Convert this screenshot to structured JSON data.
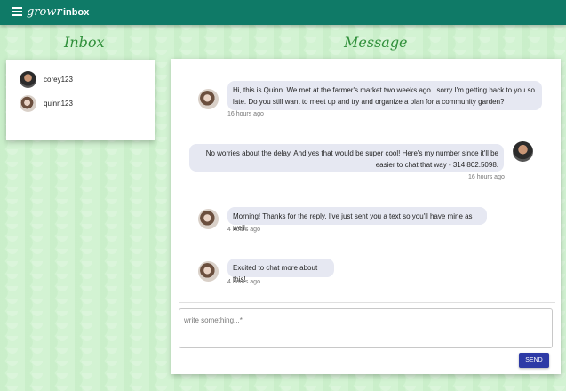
{
  "topbar": {
    "brand": "growr",
    "section": "inbox",
    "menu_icon": "hamburger-menu-icon"
  },
  "headings": {
    "inbox": "Inbox",
    "message": "Message"
  },
  "inbox": {
    "items": [
      {
        "name": "corey123",
        "avatar": "avatar-corey"
      },
      {
        "name": "quinn123",
        "avatar": "avatar-quinn"
      }
    ]
  },
  "messages": [
    {
      "text": "Hi, this is Quinn. We met at the farmer's market two weeks ago...sorry I'm getting back to you so late. Do you still want to meet up and try and organize a plan for a community garden?",
      "time": "16 hours ago",
      "side": "left"
    },
    {
      "text": "No worries about the delay. And yes that would be super cool! Here's my number since it'll be easier to chat that way - 314.802.5098.",
      "time": "16 hours ago",
      "side": "right"
    },
    {
      "text": "Morning! Thanks for the reply, I've just sent you a text so you'll have mine as well.",
      "time": "4 hours ago",
      "side": "left"
    },
    {
      "text": "Excited to chat more about this!",
      "time": "4 hours ago",
      "side": "left"
    }
  ],
  "compose": {
    "placeholder": "write something...*",
    "send_label": "SEND"
  },
  "colors": {
    "topbar": "#0f7a67",
    "heading": "#2f8f3a",
    "send": "#2d3aa6",
    "bubble": "#e6e8f2",
    "background": "#d3f3d3"
  }
}
